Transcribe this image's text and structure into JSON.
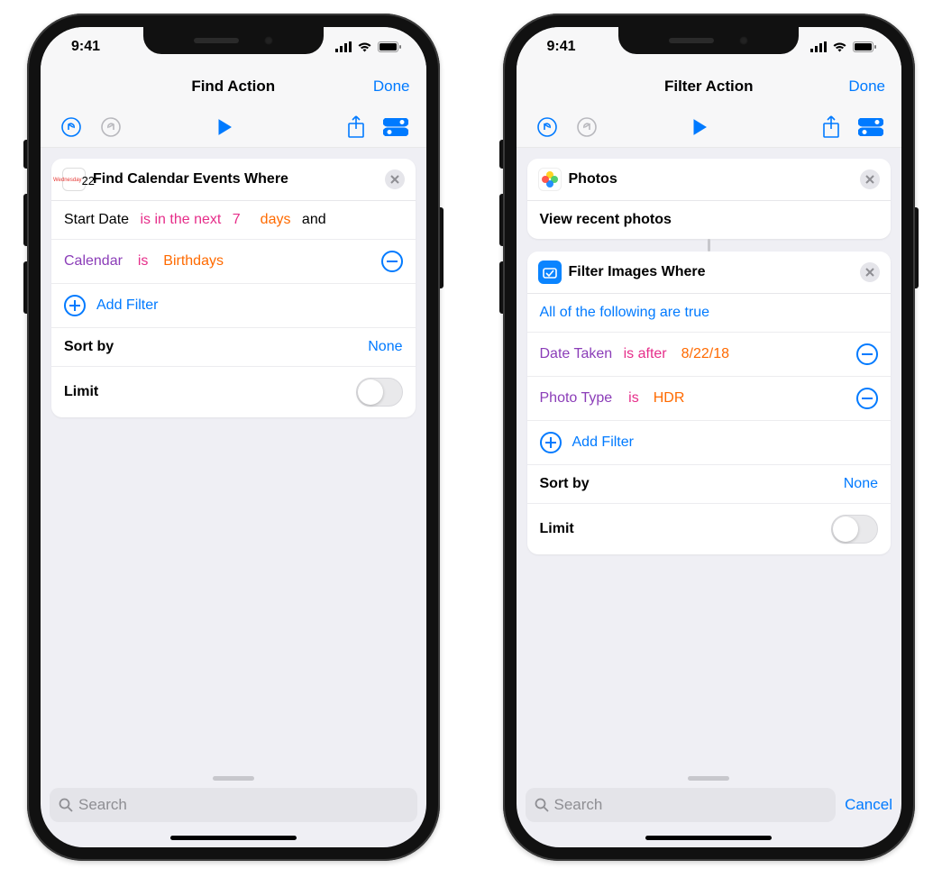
{
  "status": {
    "time": "9:41"
  },
  "left": {
    "nav": {
      "title": "Find Action",
      "done": "Done"
    },
    "card": {
      "icon_day": "22",
      "icon_wd": "Wednesday",
      "title": "Find Calendar Events Where",
      "r1_a": "Start Date",
      "r1_b": "is in the next",
      "r1_c": "7",
      "r1_d": "days",
      "r1_e": "and",
      "r2_a": "Calendar",
      "r2_b": "is",
      "r2_c": "Birthdays",
      "add_filter": "Add Filter",
      "sort_label": "Sort by",
      "sort_value": "None",
      "limit_label": "Limit"
    },
    "search_placeholder": "Search"
  },
  "right": {
    "nav": {
      "title": "Filter Action",
      "done": "Done"
    },
    "photos_card": {
      "title": "Photos",
      "subtitle": "View recent photos"
    },
    "filter_card": {
      "title": "Filter Images Where",
      "cond_header": "All of the following are true",
      "r1_a": "Date Taken",
      "r1_b": "is after",
      "r1_c": "8/22/18",
      "r2_a": "Photo Type",
      "r2_b": "is",
      "r2_c": "HDR",
      "add_filter": "Add Filter",
      "sort_label": "Sort by",
      "sort_value": "None",
      "limit_label": "Limit"
    },
    "search_placeholder": "Search",
    "cancel": "Cancel"
  }
}
